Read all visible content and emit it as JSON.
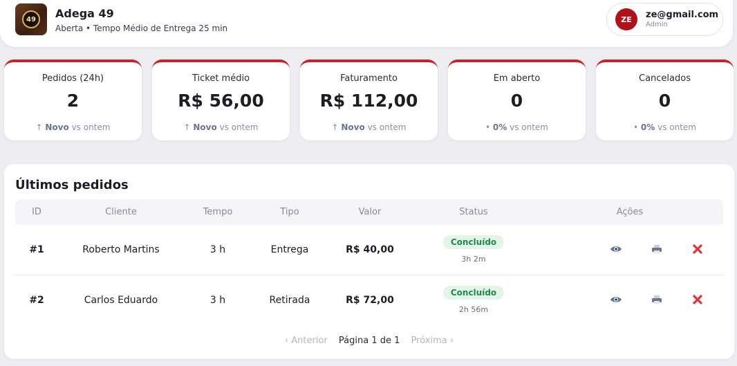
{
  "header": {
    "logo_text": "49",
    "store_name": "Adega 49",
    "store_status": "Aberta • Tempo Médio de Entrega 25 min",
    "user": {
      "initials": "ZE",
      "email": "ze@gmail.com",
      "role": "Admin"
    }
  },
  "stats": [
    {
      "label": "Pedidos (24h)",
      "value": "2",
      "trend_icon": "↑",
      "trend": "Novo",
      "trend_suffix": "vs ontem"
    },
    {
      "label": "Ticket médio",
      "value": "R$ 56,00",
      "trend_icon": "↑",
      "trend": "Novo",
      "trend_suffix": "vs ontem"
    },
    {
      "label": "Faturamento",
      "value": "R$ 112,00",
      "trend_icon": "↑",
      "trend": "Novo",
      "trend_suffix": "vs ontem"
    },
    {
      "label": "Em aberto",
      "value": "0",
      "trend_icon": "•",
      "trend": "0%",
      "trend_suffix": "vs ontem"
    },
    {
      "label": "Cancelados",
      "value": "0",
      "trend_icon": "•",
      "trend": "0%",
      "trend_suffix": "vs ontem"
    }
  ],
  "orders": {
    "title": "Últimos pedidos",
    "columns": [
      "ID",
      "Cliente",
      "Tempo",
      "Tipo",
      "Valor",
      "Status",
      "Ações"
    ],
    "rows": [
      {
        "id": "#1",
        "client": "Roberto Martins",
        "time": "3 h",
        "type": "Entrega",
        "value": "R$ 40,00",
        "status": "Concluído",
        "elapsed": "3h 2m"
      },
      {
        "id": "#2",
        "client": "Carlos Eduardo",
        "time": "3 h",
        "type": "Retirada",
        "value": "R$ 72,00",
        "status": "Concluído",
        "elapsed": "2h 56m"
      }
    ],
    "pagination": {
      "prev": "‹ Anterior",
      "current": "Página 1 de 1",
      "next": "Próxima ›"
    }
  },
  "icons": {
    "view": "eye-icon",
    "print": "printer-icon",
    "cancel": "close-icon"
  },
  "colors": {
    "accent": "#c0262d",
    "avatar": "#b0111a",
    "success_bg": "#e3f5e9",
    "success_text": "#1f8a4a"
  }
}
